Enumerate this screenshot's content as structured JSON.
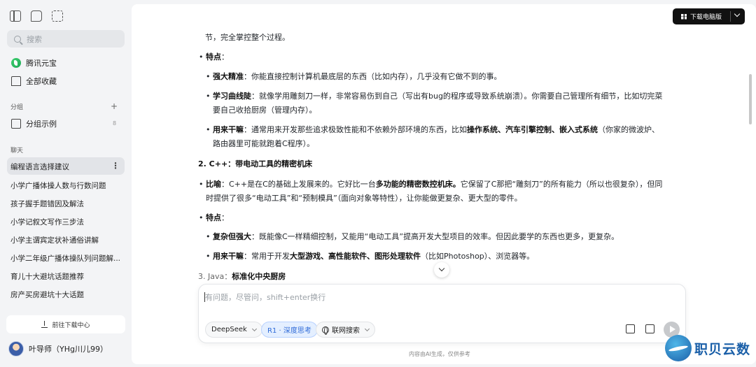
{
  "sidebar": {
    "search_placeholder": "搜索",
    "nav": [
      {
        "label": "腾讯元宝",
        "icon": "yuanbao-logo-icon"
      },
      {
        "label": "全部收藏",
        "icon": "bookmark-icon"
      }
    ],
    "group_section": {
      "label": "分组",
      "add": "+",
      "items": [
        {
          "label": "分组示例",
          "count": "8"
        }
      ]
    },
    "chat_section": {
      "label": "聊天"
    },
    "chats": [
      "编程语言选择建议",
      "小学广播体操人数与行数问题",
      "孩子握手题错因及解法",
      "小学记叙文写作三步法",
      "小学主谓宾定状补通俗讲解",
      "小学二年级广播体操队列问题解...",
      "育儿十大避坑话题推荐",
      "房产买房避坑十大话题"
    ],
    "download_center": "前往下载中心",
    "user_name": "叶导师（YHg川儿99）"
  },
  "header": {
    "download_pc": "下载电脑版"
  },
  "content": {
    "l0": "节，完全掌控整个过程。",
    "l1": "特点",
    "l2a": "强大精准",
    "l2b": "：你能直接控制计算机最底层的东西（比如内存），几乎没有它做不到的事。",
    "l3a": "学习曲线陡",
    "l3b": "：就像学用雕刻刀一样，非常容易伤到自己（写出有bug的程序或导致系统崩溃）。你需要自己管理所有细节，比如切完菜",
    "l4": "要自己收拾厨房（管理内存）。",
    "l5a": "用来干嘛",
    "l5b": "：通常用来开发那些追求极致性能和不依赖外部环境的东西，比如",
    "l5c": "操作系统、汽车引擎控制、嵌入式系统",
    "l5d": "（你家的微波炉、",
    "l6": "路由器里可能就跑着C程序）。",
    "h2": "2. C++：带电动工具的精密机床",
    "l7a": "比喻",
    "l7b": "：C++是在C的基础上发展来的。它好比一台",
    "l7c": "多功能的精密数控机床。",
    "l7d": "它保留了C那把“雕刻刀”的所有能力（所以也很复杂），但同",
    "l8": "时提供了很多“电动工具”和“预制模具”（面向对象等特性），让你能做更复杂、更大型的零件。",
    "l9": "特点",
    "l10a": "复杂但强大",
    "l10b": "：既能像C一样精细控制，又能用“电动工具”提高开发大型项目的效率。但因此要学的东西也更多，更复杂。",
    "l11a": "用来干嘛",
    "l11b": "：常用于开发",
    "l11c": "大型游戏、高性能软件、图形处理软件",
    "l11d": "（比如Photoshop）、浏览器等。",
    "h3a": "3. Java：",
    "h3b": "标准化中央厨房"
  },
  "input": {
    "placeholder": "有问题，尽管问，shift+enter换行",
    "model": "DeepSeek",
    "deep_think": "R1 · 深度思考",
    "web_search": "联网搜索"
  },
  "footer": "内容由AI生成，仅供参考",
  "watermark": "职贝云数"
}
